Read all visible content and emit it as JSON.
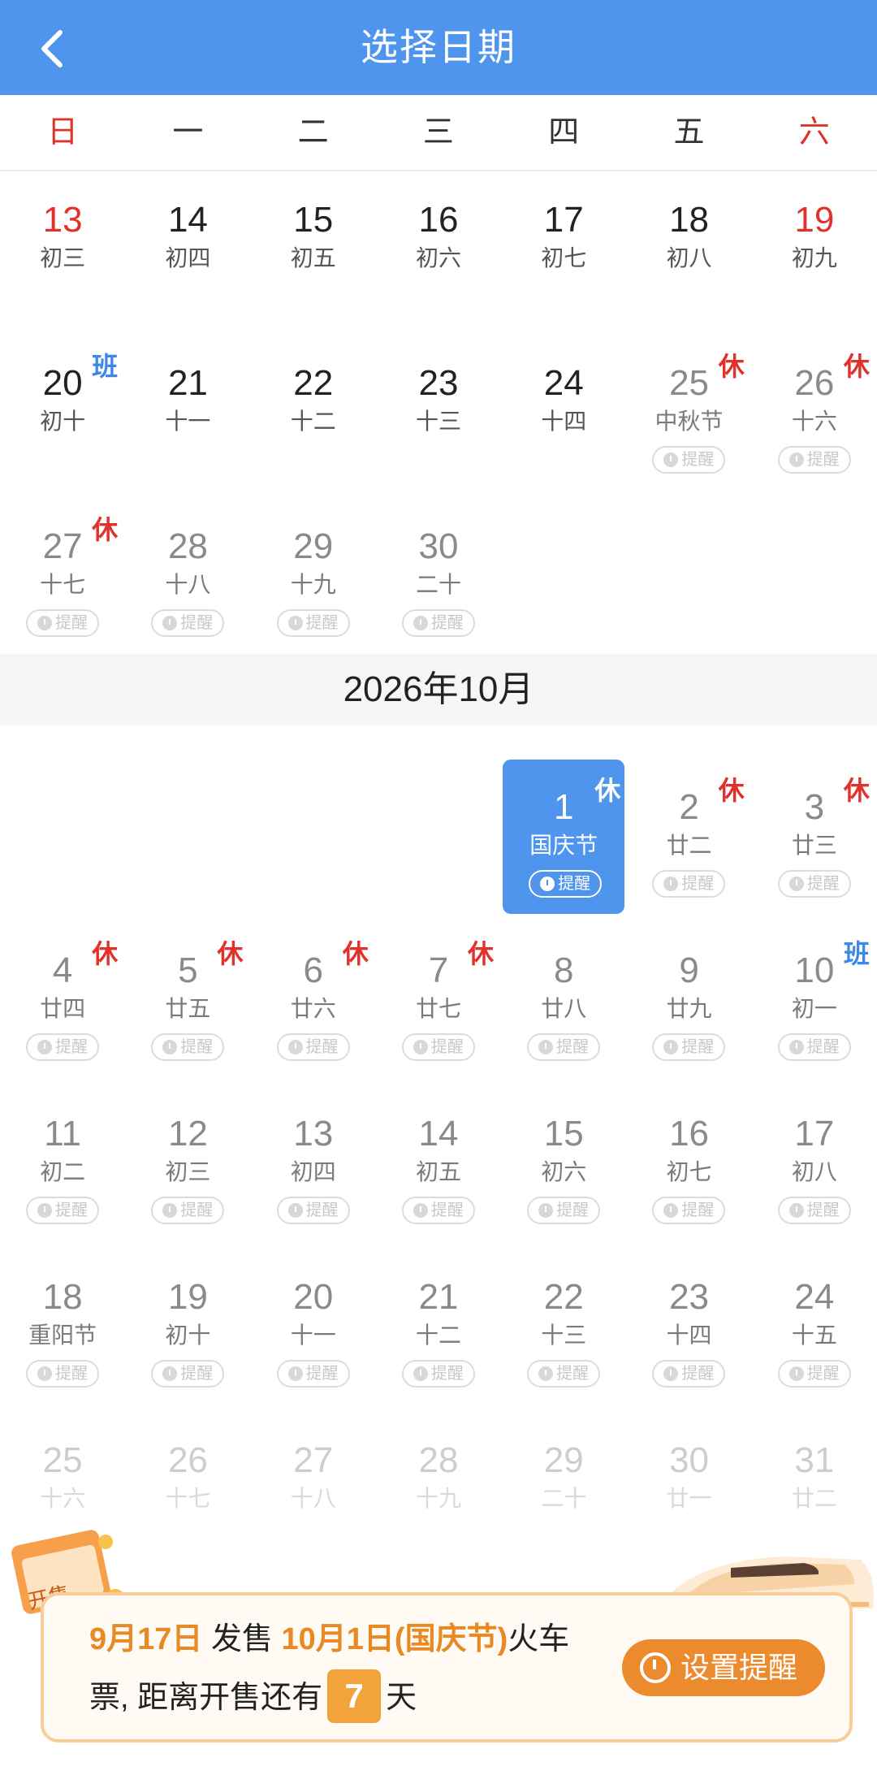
{
  "header": {
    "title": "选择日期",
    "back_icon": "chevron-left-icon"
  },
  "weekdays": [
    "日",
    "一",
    "二",
    "三",
    "四",
    "五",
    "六"
  ],
  "colors": {
    "primary": "#4f95ee",
    "holiday_red": "#e0312b",
    "workday_blue": "#3d87e6",
    "orange": "#ec8a2e"
  },
  "month_label": "2026年10月",
  "remind_label": "提醒",
  "sep_rows": [
    [
      {
        "d": "13",
        "l": "初三",
        "red": true
      },
      {
        "d": "14",
        "l": "初四"
      },
      {
        "d": "15",
        "l": "初五"
      },
      {
        "d": "16",
        "l": "初六"
      },
      {
        "d": "17",
        "l": "初七"
      },
      {
        "d": "18",
        "l": "初八"
      },
      {
        "d": "19",
        "l": "初九",
        "red": true
      }
    ],
    [
      {
        "d": "20",
        "l": "初十",
        "tag": "班",
        "tag_type": "work"
      },
      {
        "d": "21",
        "l": "十一"
      },
      {
        "d": "22",
        "l": "十二"
      },
      {
        "d": "23",
        "l": "十三"
      },
      {
        "d": "24",
        "l": "十四"
      },
      {
        "d": "25",
        "l": "中秋节",
        "tag": "休",
        "tag_type": "rest",
        "inactive": true,
        "remind": true
      },
      {
        "d": "26",
        "l": "十六",
        "tag": "休",
        "tag_type": "rest",
        "inactive": true,
        "remind": true
      }
    ],
    [
      {
        "d": "27",
        "l": "十七",
        "tag": "休",
        "tag_type": "rest",
        "inactive": true,
        "remind": true
      },
      {
        "d": "28",
        "l": "十八",
        "inactive": true,
        "remind": true
      },
      {
        "d": "29",
        "l": "十九",
        "inactive": true,
        "remind": true
      },
      {
        "d": "30",
        "l": "二十",
        "inactive": true,
        "remind": true
      },
      null,
      null,
      null
    ]
  ],
  "oct_rows": [
    [
      null,
      null,
      null,
      null,
      {
        "d": "1",
        "l": "国庆节",
        "tag": "休",
        "tag_type": "rest",
        "selected": true,
        "remind": true
      },
      {
        "d": "2",
        "l": "廿二",
        "tag": "休",
        "tag_type": "rest",
        "inactive": true,
        "remind": true
      },
      {
        "d": "3",
        "l": "廿三",
        "tag": "休",
        "tag_type": "rest",
        "inactive": true,
        "remind": true
      }
    ],
    [
      {
        "d": "4",
        "l": "廿四",
        "tag": "休",
        "tag_type": "rest",
        "inactive": true,
        "remind": true
      },
      {
        "d": "5",
        "l": "廿五",
        "tag": "休",
        "tag_type": "rest",
        "inactive": true,
        "remind": true
      },
      {
        "d": "6",
        "l": "廿六",
        "tag": "休",
        "tag_type": "rest",
        "inactive": true,
        "remind": true
      },
      {
        "d": "7",
        "l": "廿七",
        "tag": "休",
        "tag_type": "rest",
        "inactive": true,
        "remind": true
      },
      {
        "d": "8",
        "l": "廿八",
        "inactive": true,
        "remind": true
      },
      {
        "d": "9",
        "l": "廿九",
        "inactive": true,
        "remind": true
      },
      {
        "d": "10",
        "l": "初一",
        "tag": "班",
        "tag_type": "work",
        "inactive": true,
        "remind": true
      }
    ],
    [
      {
        "d": "11",
        "l": "初二",
        "inactive": true,
        "remind": true
      },
      {
        "d": "12",
        "l": "初三",
        "inactive": true,
        "remind": true
      },
      {
        "d": "13",
        "l": "初四",
        "inactive": true,
        "remind": true
      },
      {
        "d": "14",
        "l": "初五",
        "inactive": true,
        "remind": true
      },
      {
        "d": "15",
        "l": "初六",
        "inactive": true,
        "remind": true
      },
      {
        "d": "16",
        "l": "初七",
        "inactive": true,
        "remind": true
      },
      {
        "d": "17",
        "l": "初八",
        "inactive": true,
        "remind": true
      }
    ],
    [
      {
        "d": "18",
        "l": "重阳节",
        "inactive": true,
        "remind": true
      },
      {
        "d": "19",
        "l": "初十",
        "inactive": true,
        "remind": true
      },
      {
        "d": "20",
        "l": "十一",
        "inactive": true,
        "remind": true
      },
      {
        "d": "21",
        "l": "十二",
        "inactive": true,
        "remind": true
      },
      {
        "d": "22",
        "l": "十三",
        "inactive": true,
        "remind": true
      },
      {
        "d": "23",
        "l": "十四",
        "inactive": true,
        "remind": true
      },
      {
        "d": "24",
        "l": "十五",
        "inactive": true,
        "remind": true
      }
    ],
    [
      {
        "d": "25",
        "l": "十六",
        "faded": true
      },
      {
        "d": "26",
        "l": "十七",
        "faded": true
      },
      {
        "d": "27",
        "l": "十八",
        "faded": true
      },
      {
        "d": "28",
        "l": "十九",
        "faded": true
      },
      {
        "d": "29",
        "l": "二十",
        "faded": true
      },
      {
        "d": "30",
        "l": "廿一",
        "faded": true
      },
      {
        "d": "31",
        "l": "廿二",
        "faded": true
      }
    ]
  ],
  "banner": {
    "sale_date": "9月17日",
    "sale_word": " 发售 ",
    "travel_date": "10月1日(国庆节)",
    "train_word": "火车",
    "line2_prefix": "票, 距离开售还有",
    "days": "7",
    "line2_suffix": "天",
    "button_label": "设置提醒",
    "sale_art_label": "开售"
  }
}
